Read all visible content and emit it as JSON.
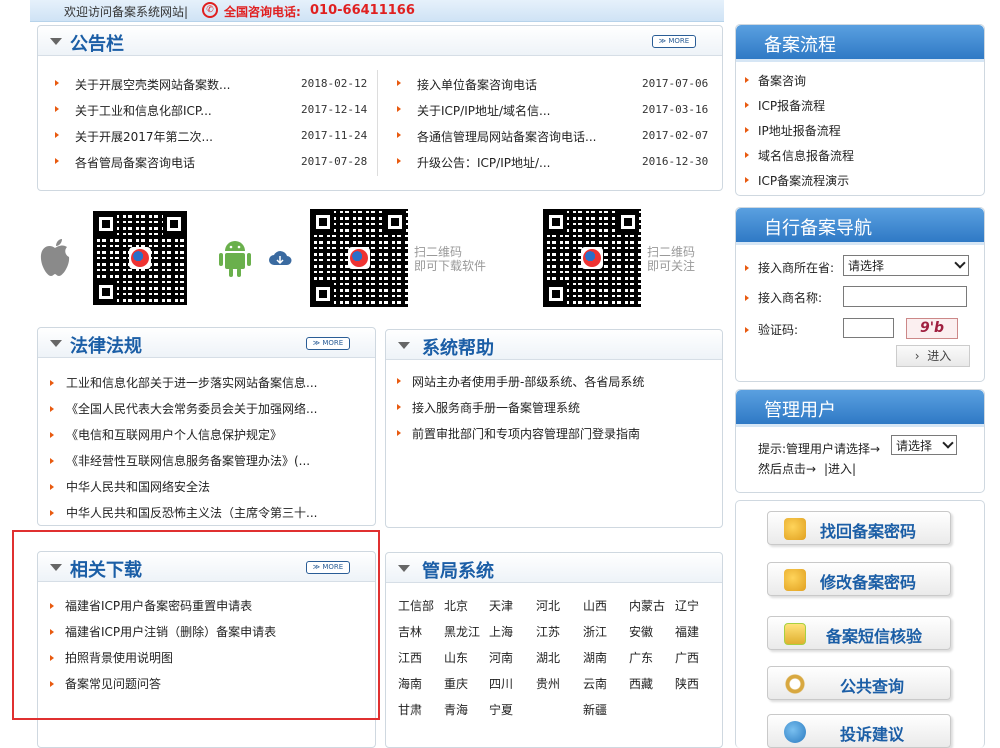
{
  "topbar": {
    "welcome": "欢迎访问备案系统网站|",
    "phone_label": "全国咨询电话:",
    "phone_number": "010-66411166"
  },
  "more_label": "≫ MORE",
  "notice": {
    "title": "公告栏",
    "left_items": [
      {
        "text": "关于开展空壳类网站备案数...",
        "date": "2018-02-12"
      },
      {
        "text": "关于工业和信息化部ICP...",
        "date": "2017-12-14"
      },
      {
        "text": "关于开展2017年第二次...",
        "date": "2017-11-24"
      },
      {
        "text": "各省管局备案咨询电话",
        "date": "2017-07-28"
      }
    ],
    "right_items": [
      {
        "text": "接入单位备案咨询电话",
        "date": "2017-07-06"
      },
      {
        "text": "关于ICP/IP地址/域名信...",
        "date": "2017-03-16"
      },
      {
        "text": "各通信管理局网站备案咨询电话...",
        "date": "2017-02-07"
      },
      {
        "text": "升级公告：ICP/IP地址/...",
        "date": "2016-12-30"
      }
    ]
  },
  "qr": {
    "download_text1": "扫二维码",
    "download_text2": "即可下载软件",
    "follow_text1": "扫二维码",
    "follow_text2": "即可关注"
  },
  "law": {
    "title": "法律法规",
    "items": [
      "工业和信息化部关于进一步落实网站备案信息...",
      "《全国人民代表大会常务委员会关于加强网络...",
      "《电信和互联网用户个人信息保护规定》",
      "《非经营性互联网信息服务备案管理办法》(...",
      "中华人民共和国网络安全法",
      "中华人民共和国反恐怖主义法（主席令第三十..."
    ]
  },
  "help": {
    "title": "系统帮助",
    "items": [
      "网站主办者使用手册-部级系统、各省局系统",
      "接入服务商手册一备案管理系统",
      "前置审批部门和专项内容管理部门登录指南"
    ]
  },
  "download": {
    "title": "相关下载",
    "items": [
      "福建省ICP用户备案密码重置申请表",
      "福建省ICP用户注销（删除）备案申请表",
      "拍照背景使用说明图",
      "备案常见问题问答"
    ]
  },
  "bureau": {
    "title": "管局系统",
    "rows": [
      [
        "工信部",
        "北京",
        "天津",
        "河北",
        "山西",
        "内蒙古",
        "辽宁"
      ],
      [
        "吉林",
        "黑龙江",
        "上海",
        "江苏",
        "浙江",
        "安徽",
        "福建"
      ],
      [
        "江西",
        "山东",
        "河南",
        "湖北",
        "湖南",
        "广东",
        "广西"
      ],
      [
        "海南",
        "重庆",
        "四川",
        "贵州",
        "云南",
        "西藏",
        "陕西"
      ],
      [
        "甘肃",
        "青海",
        "宁夏",
        "",
        "新疆",
        "",
        ""
      ]
    ]
  },
  "process": {
    "title": "备案流程",
    "items": [
      "备案咨询",
      "ICP报备流程",
      "IP地址报备流程",
      "域名信息报备流程",
      "ICP备案流程演示"
    ]
  },
  "nav": {
    "title": "自行备案导航",
    "province_label": "接入商所在省:",
    "province_value": "请选择",
    "name_label": "接入商名称:",
    "captcha_label": "验证码:",
    "captcha_text": "9'b",
    "enter_label": "进入"
  },
  "admin": {
    "title": "管理用户",
    "hint": "提示:管理用户请选择→",
    "select_value": "请选择",
    "then": "然后点击→",
    "enter_label": "|进入|"
  },
  "buttons": [
    "找回备案密码",
    "修改备案密码",
    "备案短信核验",
    "公共查询",
    "投诉建议"
  ],
  "colors": {
    "accent": "#1b5ea6",
    "orange": "#e85a10",
    "red": "#e02020",
    "header_blue": "#3a84cf"
  }
}
